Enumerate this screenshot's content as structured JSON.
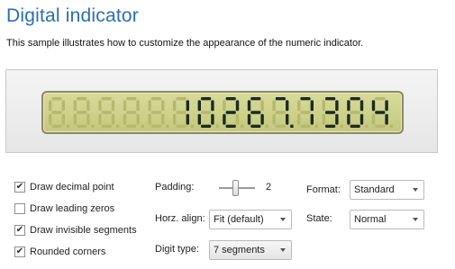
{
  "header": {
    "title": "Digital indicator",
    "description": "This sample illustrates how to customize the appearance of the numeric indicator."
  },
  "indicator": {
    "value_text": "10267.7304",
    "digit_count": 14,
    "colors": {
      "lit": "#1e2a22",
      "ghost": "#b5b86f",
      "background": "#d0d38c"
    }
  },
  "options": {
    "draw_decimal_point": {
      "label": "Draw decimal point",
      "checked": true
    },
    "draw_leading_zeros": {
      "label": "Draw leading zeros",
      "checked": false
    },
    "draw_invisible_segments": {
      "label": "Draw invisible segments",
      "checked": true
    },
    "rounded_corners": {
      "label": "Rounded corners",
      "checked": true
    }
  },
  "settings": {
    "padding": {
      "label": "Padding:",
      "value": "2"
    },
    "horz_align": {
      "label": "Horz. align:",
      "value": "Fit (default)"
    },
    "digit_type": {
      "label": "Digit type:",
      "value": "7 segments"
    },
    "format": {
      "label": "Format:",
      "value": "Standard"
    },
    "state": {
      "label": "State:",
      "value": "Normal"
    }
  },
  "check_glyph": "✔"
}
